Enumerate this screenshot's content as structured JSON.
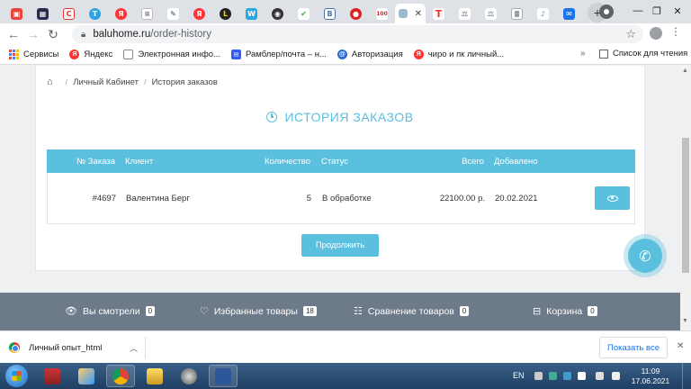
{
  "browser": {
    "tab_icons": [
      "bookmark-icon",
      "film-icon",
      "c-icon",
      "telegram-icon",
      "yandex-icon",
      "chart-icon",
      "pen-icon",
      "yandex-icon",
      "ln-icon",
      "w-icon",
      "eye-icon",
      "check-icon",
      "vk-icon",
      "red-circle-icon",
      "hundred-icon"
    ],
    "address": {
      "host": "baluhome.ru",
      "path": "/order-history"
    },
    "bookmarks": [
      {
        "label": "Сервисы",
        "icon": "apps-icon"
      },
      {
        "label": "Яндекс",
        "icon": "yandex-icon"
      },
      {
        "label": "Электронная инфо...",
        "icon": "document-icon"
      },
      {
        "label": "Рамблер/почта – н...",
        "icon": "mail-icon"
      },
      {
        "label": "Авторизация",
        "icon": "login-icon"
      },
      {
        "label": "чиро и пк личный...",
        "icon": "yandex-icon"
      }
    ],
    "bookmarks_more": "»",
    "reading_list": "Список для чтения"
  },
  "page": {
    "breadcrumb": [
      "Личный Кабинет",
      "История заказов"
    ],
    "title": "ИСТОРИЯ ЗАКАЗОВ",
    "table": {
      "headers": {
        "order": "№ Заказа",
        "client": "Клиент",
        "quantity": "Количество",
        "status": "Статус",
        "total": "Всего",
        "added": "Добавлено"
      },
      "rows": [
        {
          "order": "#4697",
          "client": "Валентина Берг",
          "quantity": "5",
          "status": "В обработке",
          "total": "22100.00 р.",
          "added": "20.02.2021"
        }
      ]
    },
    "continue_label": "Продолжить"
  },
  "footer": {
    "viewed": {
      "label": "Вы смотрели",
      "count": "0"
    },
    "favorites": {
      "label": "Избранные товары",
      "count": "18"
    },
    "compare": {
      "label": "Сравнение товаров",
      "count": "0"
    },
    "cart": {
      "label": "Корзина",
      "count": "0"
    }
  },
  "downloads": {
    "item": "Личный опыт_html",
    "show_all": "Показать все"
  },
  "taskbar": {
    "lang": "EN",
    "time": "11:09",
    "date": "17.06.2021"
  },
  "colors": {
    "accent": "#5bc0de",
    "footer_bg": "#6c7a89"
  }
}
